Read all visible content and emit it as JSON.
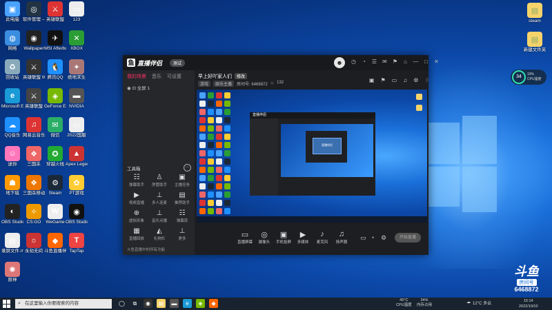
{
  "colors": {
    "accent": "#ff3366",
    "desktop": "#0c48a8"
  },
  "desktop_icons_left": [
    {
      "label": "此电脑",
      "glyph": "▣",
      "color": "#4aa3ff"
    },
    {
      "label": "软件管理 – 壁纸",
      "glyph": "◎",
      "color": "#223344"
    },
    {
      "label": "英雄联盟",
      "glyph": "⚔",
      "color": "#d33"
    },
    {
      "label": "123",
      "glyph": "▭",
      "color": "#eee"
    },
    {
      "label": "网络",
      "glyph": "◍",
      "color": "#3b8de0"
    },
    {
      "label": "Wallpaper",
      "glyph": "◉",
      "color": "#222"
    },
    {
      "label": "MSI Afterburner",
      "glyph": "✈",
      "color": "#111"
    },
    {
      "label": "XBOX",
      "glyph": "✕",
      "color": "#2a9d34"
    },
    {
      "label": "回收站",
      "glyph": "♻",
      "color": "#8ab"
    },
    {
      "label": "英雄联盟 WeGame版",
      "glyph": "⚔",
      "color": "#333"
    },
    {
      "label": "腾讯QQ",
      "glyph": "🐧",
      "color": "#1e90ff"
    },
    {
      "label": "绝地求生",
      "glyph": "✦",
      "color": "#a77"
    },
    {
      "label": "Microsoft Edge",
      "glyph": "e",
      "color": "#1a9ad6"
    },
    {
      "label": "英雄联盟",
      "glyph": "⚔",
      "color": "#444"
    },
    {
      "label": "GeForce Experience",
      "glyph": "◈",
      "color": "#76b900"
    },
    {
      "label": "NVIDIA",
      "glyph": "▬",
      "color": "#555"
    },
    {
      "label": "QQ音乐",
      "glyph": "☁",
      "color": "#1e90ff"
    },
    {
      "label": "网易云音乐",
      "glyph": "♫",
      "color": "#d33"
    },
    {
      "label": "微信",
      "glyph": "✉",
      "color": "#2aae67"
    },
    {
      "label": "2022国服",
      "glyph": "▭",
      "color": "#eee"
    },
    {
      "label": "迷你",
      "glyph": "☺",
      "color": "#f7b"
    },
    {
      "label": "三国杀",
      "glyph": "❖",
      "color": "#e66"
    },
    {
      "label": "穿越火线",
      "glyph": "✪",
      "color": "#2a3"
    },
    {
      "label": "Apex Legends",
      "glyph": "▲",
      "color": "#c33"
    },
    {
      "label": "地下城",
      "glyph": "☗",
      "color": "#f90"
    },
    {
      "label": "三国杀移动版",
      "glyph": "❖",
      "color": "#e70"
    },
    {
      "label": "Steam",
      "glyph": "⚙",
      "color": "#1b2838"
    },
    {
      "label": "PT游戏",
      "glyph": "✿",
      "color": "#fc3"
    },
    {
      "label": "OBS Studio",
      "glyph": "◐",
      "color": "#222"
    },
    {
      "label": "CS:GO",
      "glyph": "✧",
      "color": "#e90"
    },
    {
      "label": "WeGame",
      "glyph": "W",
      "color": "#eee"
    },
    {
      "label": "OBS Studio",
      "glyph": "◉",
      "color": "#111"
    },
    {
      "label": "录屏文件.mp4",
      "glyph": "▤",
      "color": "#eee"
    },
    {
      "label": "永劫无间",
      "glyph": "☼",
      "color": "#c33"
    },
    {
      "label": "斗鱼直播伴侣",
      "glyph": "◆",
      "color": "#f60"
    },
    {
      "label": "TapTap",
      "glyph": "T",
      "color": "#e44"
    },
    {
      "label": "原神",
      "glyph": "✺",
      "color": "#d77"
    }
  ],
  "desktop_icons_right": [
    {
      "label": "steam",
      "glyph": "▤",
      "color": "#f5d36b"
    },
    {
      "label": "新建文件夹",
      "glyph": "▤",
      "color": "#f5d36b"
    }
  ],
  "cpu_widget": {
    "percent": "34",
    "label": "CPU温度",
    "sub": "10%"
  },
  "app": {
    "title": "直播伴侣",
    "version": "测试",
    "avatar": "☻",
    "top_icons": [
      "◷",
      "◔",
      "☰",
      "✉",
      "⚑",
      "⌂",
      "—",
      "□",
      "✕"
    ],
    "left_tabs": [
      {
        "label": "我的场景",
        "active": true
      },
      {
        "label": "音乐",
        "active": false
      },
      {
        "label": "可设置",
        "active": false
      }
    ],
    "scene": "全屏 1",
    "tools_title": "工具箱",
    "tools_more": "···",
    "tools": [
      {
        "icon": "☷",
        "label": "弹幕助手"
      },
      {
        "icon": "♙",
        "label": "房管助手"
      },
      {
        "icon": "▣",
        "label": "主播任务"
      },
      {
        "icon": "▶",
        "label": "视频直播"
      },
      {
        "icon": "⊥",
        "label": "多人连麦"
      },
      {
        "icon": "▤",
        "label": "推荐助手"
      },
      {
        "icon": "⊕",
        "label": "虚拟形象"
      },
      {
        "icon": "⊥",
        "label": "音乐点播"
      },
      {
        "icon": "☷",
        "label": "弹幕库"
      },
      {
        "icon": "▦",
        "label": "直播回放"
      },
      {
        "icon": "◭",
        "label": "礼物栏"
      },
      {
        "icon": "⊥",
        "label": "更多"
      }
    ],
    "left_footer": "斗鱼直播中的所有功能",
    "room": {
      "title": "早上好吖家人们",
      "tag": "修改",
      "category": "游戏",
      "sub_category": "娱乐主播",
      "room_id": "房间号: 6468872",
      "fans": "132"
    },
    "right_icons": [
      "▣",
      "⚑",
      "▭",
      "♫",
      "⚙",
      "♢"
    ],
    "bottom_items": [
      {
        "icon": "▭",
        "label": "直播屏幕"
      },
      {
        "icon": "◎",
        "label": "摄像头"
      },
      {
        "icon": "▣",
        "label": "手机投屏"
      },
      {
        "icon": "▶",
        "label": "多媒体"
      },
      {
        "icon": "♪",
        "label": "麦克风"
      },
      {
        "icon": "♫",
        "label": "扬声器"
      }
    ],
    "bottom_right_icons": [
      "▭",
      "◔",
      "⚙"
    ],
    "live_button": "开始直播"
  },
  "douyu": {
    "logo": "斗鱼",
    "room_label": "房间号",
    "number": "6468872"
  },
  "taskbar": {
    "search_placeholder": "在这里输入你要搜索的内容",
    "apps": [
      "◯",
      "⧉",
      "◉",
      "▤",
      "▬",
      "e",
      "◈",
      "◆"
    ],
    "cpu_temp": "45°C",
    "cpu_temp_label": "CPU温度",
    "mem": "34%",
    "mem_label": "内存占用",
    "weather": "12°C 多云",
    "time": "15:14",
    "date": "2022/10/10"
  }
}
